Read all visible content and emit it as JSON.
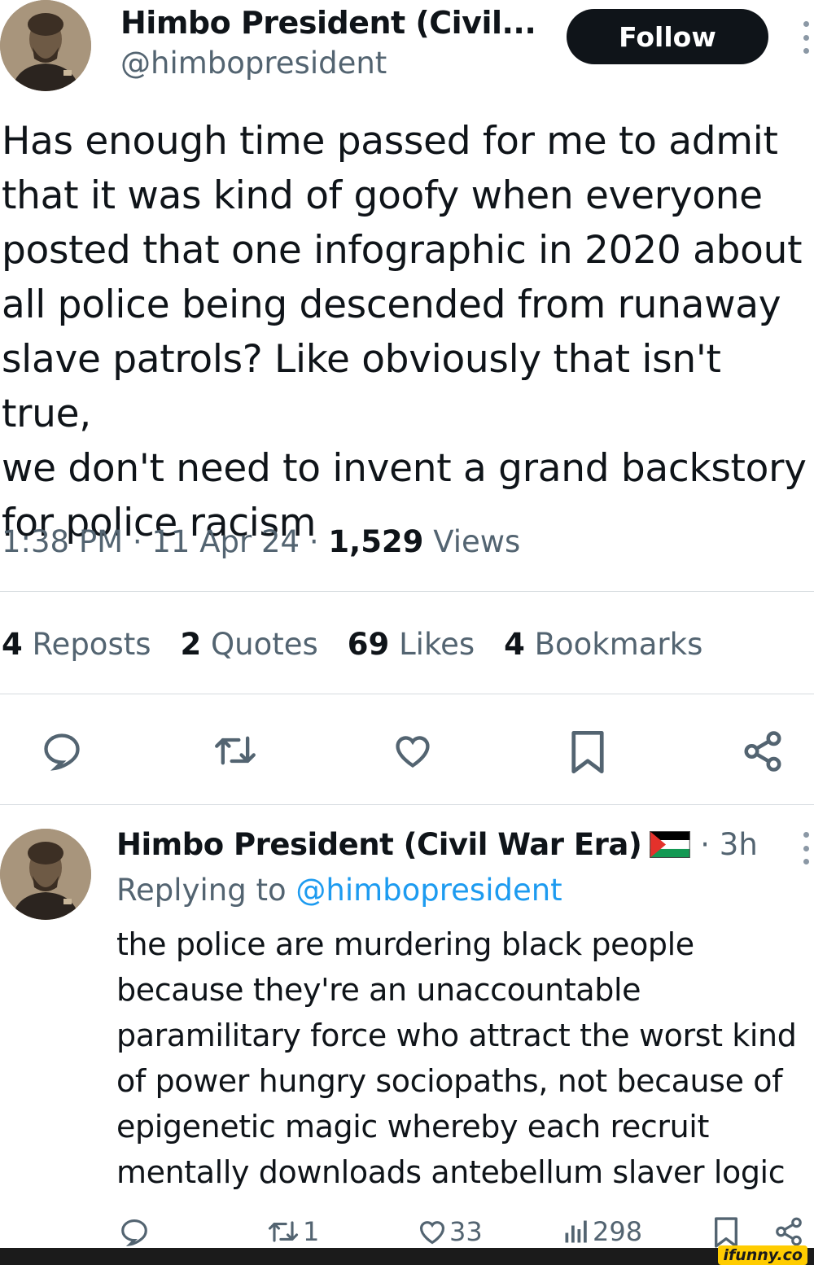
{
  "tweet": {
    "author_name": "Himbo President (Civil...",
    "handle": "@himbopresident",
    "follow_label": "Follow",
    "text": "Has enough time passed for me to admit\nthat it was kind of goofy when everyone\nposted that one infographic in 2020 about\nall police being descended from runaway\nslave patrols? Like obviously that isn't true,\nwe don't need to invent a grand backstory\nfor police racism",
    "time": "1:38 PM",
    "date": "11 Apr 24",
    "views_count": "1,529",
    "views_label": "Views",
    "separator": "·",
    "stats": [
      {
        "count": "4",
        "label": "Reposts"
      },
      {
        "count": "2",
        "label": "Quotes"
      },
      {
        "count": "69",
        "label": "Likes"
      },
      {
        "count": "4",
        "label": "Bookmarks"
      }
    ],
    "icons": [
      "reply-icon",
      "repost-icon",
      "like-icon",
      "bookmark-icon",
      "share-icon"
    ]
  },
  "reply": {
    "author_name": "Himbo President (Civil War Era)",
    "flag": "palestine-flag",
    "time": "· 3h",
    "replying_prefix": "Replying to",
    "replying_handle": "@himbopresident",
    "text": "the police are murdering black people\nbecause they're an unaccountable\nparamilitary force who attract the worst kind\nof power hungry sociopaths, not because of\nepigenetic magic whereby each recruit\nmentally downloads antebellum slaver logic",
    "reposts": "1",
    "likes": "33",
    "views": "298"
  },
  "watermark": "ifunny.co",
  "colors": {
    "text_primary": "#0f1419",
    "text_secondary": "#536471",
    "link": "#1d9bf0",
    "divider": "#d6dbdf"
  }
}
